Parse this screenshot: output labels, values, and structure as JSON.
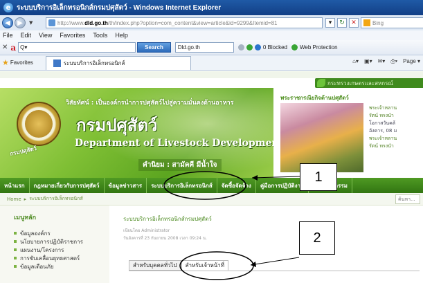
{
  "window": {
    "title": "ระบบบริการอิเล็กทรอนิกส์กรมปศุสัตว์ - Windows Internet Explorer"
  },
  "address_bar": {
    "url_prefix": "http://www.",
    "url_host": "dld.go.th",
    "url_rest": "/th/index.php?option=com_content&view=article&id=9299&Itemid=81",
    "search_placeholder": "Bing",
    "close_symbol": "✕"
  },
  "menu": [
    "File",
    "Edit",
    "View",
    "Favorites",
    "Tools",
    "Help"
  ],
  "toolbar": {
    "search_value": "Q▾",
    "search_button": "Search",
    "site_box": "Dld.go.th",
    "blocked": "0 Blocked",
    "web_protection": "Web Protection"
  },
  "favorites_bar": {
    "favorites_label": "Favorites",
    "tab_title": "ระบบบริการอิเล็กทรอนิกส์",
    "page_label": "Page ▾"
  },
  "site": {
    "ministry": "กระทรวงเกษตรและสหกรณ์",
    "slogan": "วิสัยทัศน์ : เป็นองค์กรนำการปศุสัตว์ไปสู่ความมั่นคงด้านอาหาร",
    "dept_th": "กรมปศุสัตว์",
    "dept_en": "Department of Livestock Development",
    "motto": "คำนิยม : สามัคคี มีน้ำใจ",
    "seal_text": "กรมปศุสัตว์",
    "news_title": "พระราชกรณียกิจด้านปศุสัตว์",
    "news_lines": [
      "พระเจ้าหลาน",
      "รัตน์ ทรงนำ",
      "โอกาสวันคล้",
      "อังคาร, 08 ม",
      "พระเจ้าหลาน",
      "รัตน์ ทรงนำ"
    ],
    "nav": [
      "หน้าแรก",
      "กฎหมายเกี่ยวกับการปศุสัตว์",
      "ข้อมูลข่าวสาร",
      "ระบบบริการอิเล็กทรอนิกส์",
      "จัดซื้อจัดจ้าง",
      "คู่มือการปฏิบัติงาน",
      "ปฏิทินกิจกรรม"
    ],
    "breadcrumb": [
      "Home",
      "ระบบบริการอิเล็กทรอนิกส์"
    ],
    "search_site": "ค้นหา..."
  },
  "sidebar": {
    "heading": "เมนูหลัก",
    "items": [
      "ข้อมูลองค์กร",
      "นโยบายการปฏิบัติราชการ",
      "แผนงาน/โครงการ",
      "การขับเคลื่อนยุทธศาสตร์",
      "ข้อมูลเตือนภัย"
    ]
  },
  "article": {
    "title": "ระบบบริการอิเล็กทรอนิกส์กรมปศุสัตว์",
    "author": "เขียนโดย Administrator",
    "date": "วันอังคารที่ 23 กันยายน 2008 เวลา 09:24 น.",
    "tabs": [
      "สำหรับบุคคลทั่วไป",
      "สำหรับเจ้าหน้าที่"
    ]
  },
  "annotations": {
    "callout_1": "1",
    "callout_2": "2"
  },
  "colors": {
    "nav_green": "#3f8a1a",
    "banner_green": "#7fbf34",
    "title_blue": "#1f5aa6",
    "annotation": "#000000"
  }
}
